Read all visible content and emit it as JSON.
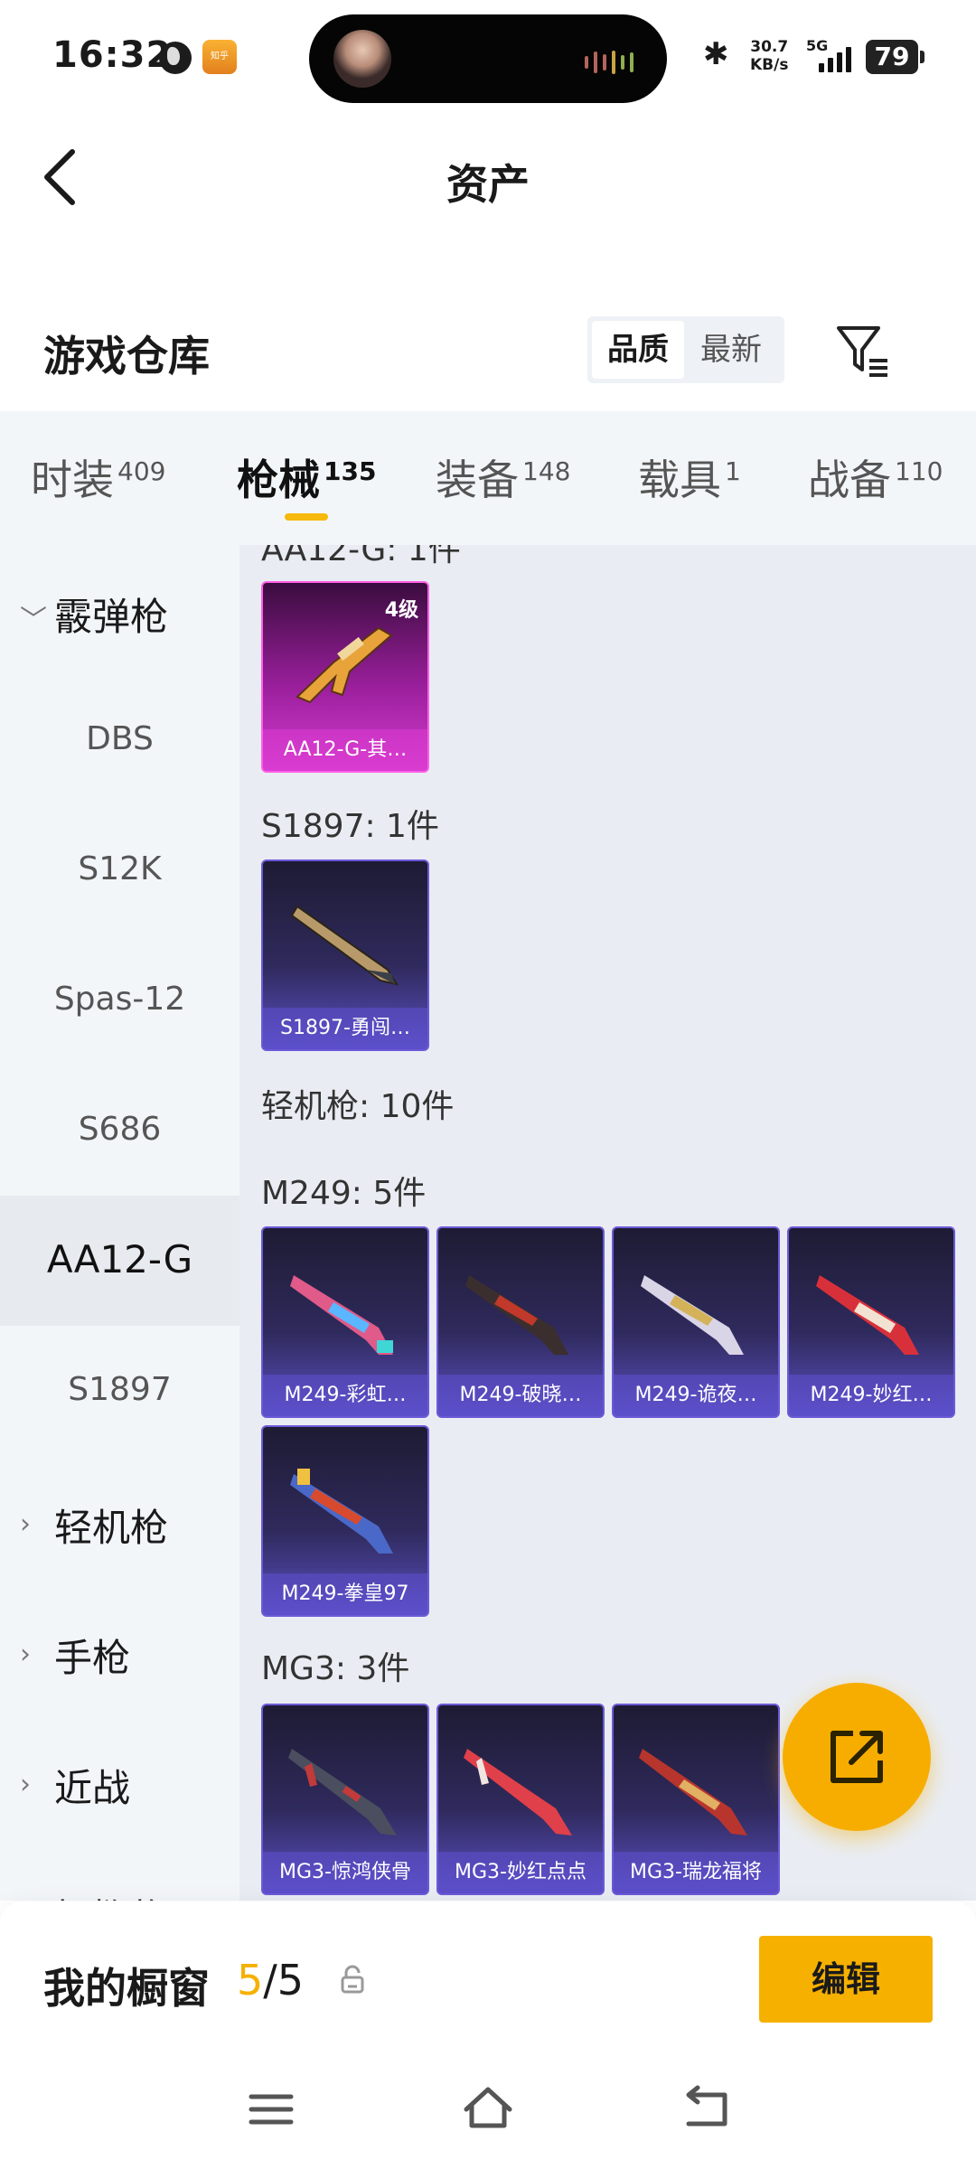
{
  "status_bar": {
    "time": "16:32",
    "app_icon_label": "知乎",
    "speed_value": "30.7",
    "speed_unit": "KB/s",
    "network": "5G",
    "battery": "79"
  },
  "header": {
    "title": "资产"
  },
  "warehouse": {
    "title": "游戏仓库",
    "sort_options": [
      "品质",
      "最新"
    ],
    "active_sort": "品质"
  },
  "tabs": [
    {
      "label": "时装",
      "count": "409"
    },
    {
      "label": "枪械",
      "count": "135"
    },
    {
      "label": "装备",
      "count": "148"
    },
    {
      "label": "载具",
      "count": "1"
    },
    {
      "label": "战备",
      "count": "110"
    }
  ],
  "active_tab": "枪械",
  "sidebar": {
    "categories": [
      {
        "label": "霰弹枪",
        "expanded": true
      },
      {
        "label": "轻机枪",
        "expanded": false
      },
      {
        "label": "手枪",
        "expanded": false
      },
      {
        "label": "近战",
        "expanded": false
      },
      {
        "label": "投掷物",
        "expanded": false
      }
    ],
    "subitems": [
      "DBS",
      "S12K",
      "Spas-12",
      "S686",
      "AA12-G",
      "S1897"
    ],
    "selected": "AA12-G"
  },
  "content": {
    "sections": [
      {
        "title": "AA12-G: 1件",
        "items": [
          {
            "name": "AA12-G-其…",
            "level": "4级",
            "rarity": "pink"
          }
        ]
      },
      {
        "title": "S1897: 1件",
        "items": [
          {
            "name": "S1897-勇闯…",
            "rarity": "purple"
          }
        ]
      },
      {
        "title": "轻机枪: 10件",
        "items": []
      },
      {
        "title": "M249: 5件",
        "items": [
          {
            "name": "M249-彩虹…",
            "rarity": "purple"
          },
          {
            "name": "M249-破晓…",
            "rarity": "purple"
          },
          {
            "name": "M249-诡夜…",
            "rarity": "purple"
          },
          {
            "name": "M249-妙红…",
            "rarity": "purple"
          },
          {
            "name": "M249-拳皇97",
            "rarity": "purple"
          }
        ]
      },
      {
        "title": "MG3: 3件",
        "items": [
          {
            "name": "MG3-惊鸿侠骨",
            "rarity": "purple"
          },
          {
            "name": "MG3-妙红点点",
            "rarity": "purple"
          },
          {
            "name": "MG3-瑞龙福将",
            "rarity": "purple"
          }
        ]
      }
    ]
  },
  "showcase": {
    "label": "我的橱窗",
    "current": "5",
    "separator": "/",
    "total": "5",
    "edit_label": "编辑"
  },
  "colors": {
    "accent": "#f6b000",
    "tab_indicator": "#f6b90b",
    "card_purple": "#5a4fc2",
    "card_pink": "#d43ccf"
  }
}
